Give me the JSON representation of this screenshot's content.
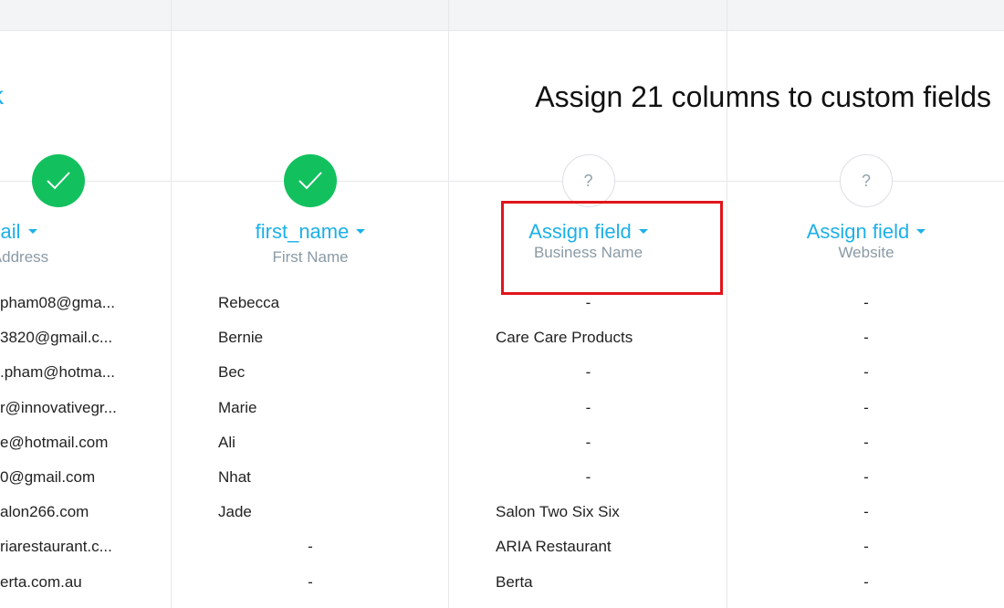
{
  "topbar": {},
  "back": {
    "label": "k"
  },
  "title": "Assign 21 columns to custom fields",
  "columns": [
    {
      "field": "email",
      "subtitle": "ail Address",
      "status": "assigned",
      "values": [
        "pham08@gma...",
        "3820@gmail.c...",
        ".pham@hotma...",
        "r@innovativegr...",
        "e@hotmail.com",
        "0@gmail.com",
        "alon266.com",
        "riarestaurant.c...",
        "erta.com.au"
      ]
    },
    {
      "field": "first_name",
      "subtitle": "First Name",
      "status": "assigned",
      "values": [
        "Rebecca",
        "Bernie",
        "Bec",
        "Marie",
        "Ali",
        "Nhat",
        "Jade",
        "-",
        "-"
      ]
    },
    {
      "field": "Assign field",
      "subtitle": "Business Name",
      "status": "unassigned",
      "status_symbol": "?",
      "values": [
        "-",
        "Care Care Products",
        "-",
        "-",
        "-",
        "-",
        "Salon Two Six Six",
        "ARIA Restaurant",
        "Berta"
      ]
    },
    {
      "field": "Assign field",
      "subtitle": "Website",
      "status": "unassigned",
      "status_symbol": "?",
      "values": [
        "-",
        "-",
        "-",
        "-",
        "-",
        "-",
        "-",
        "-",
        "-"
      ]
    }
  ],
  "colors": {
    "accent": "#1db0e8",
    "success": "#12c15d",
    "highlight": "#e0151b",
    "muted": "#8a9aa5"
  }
}
